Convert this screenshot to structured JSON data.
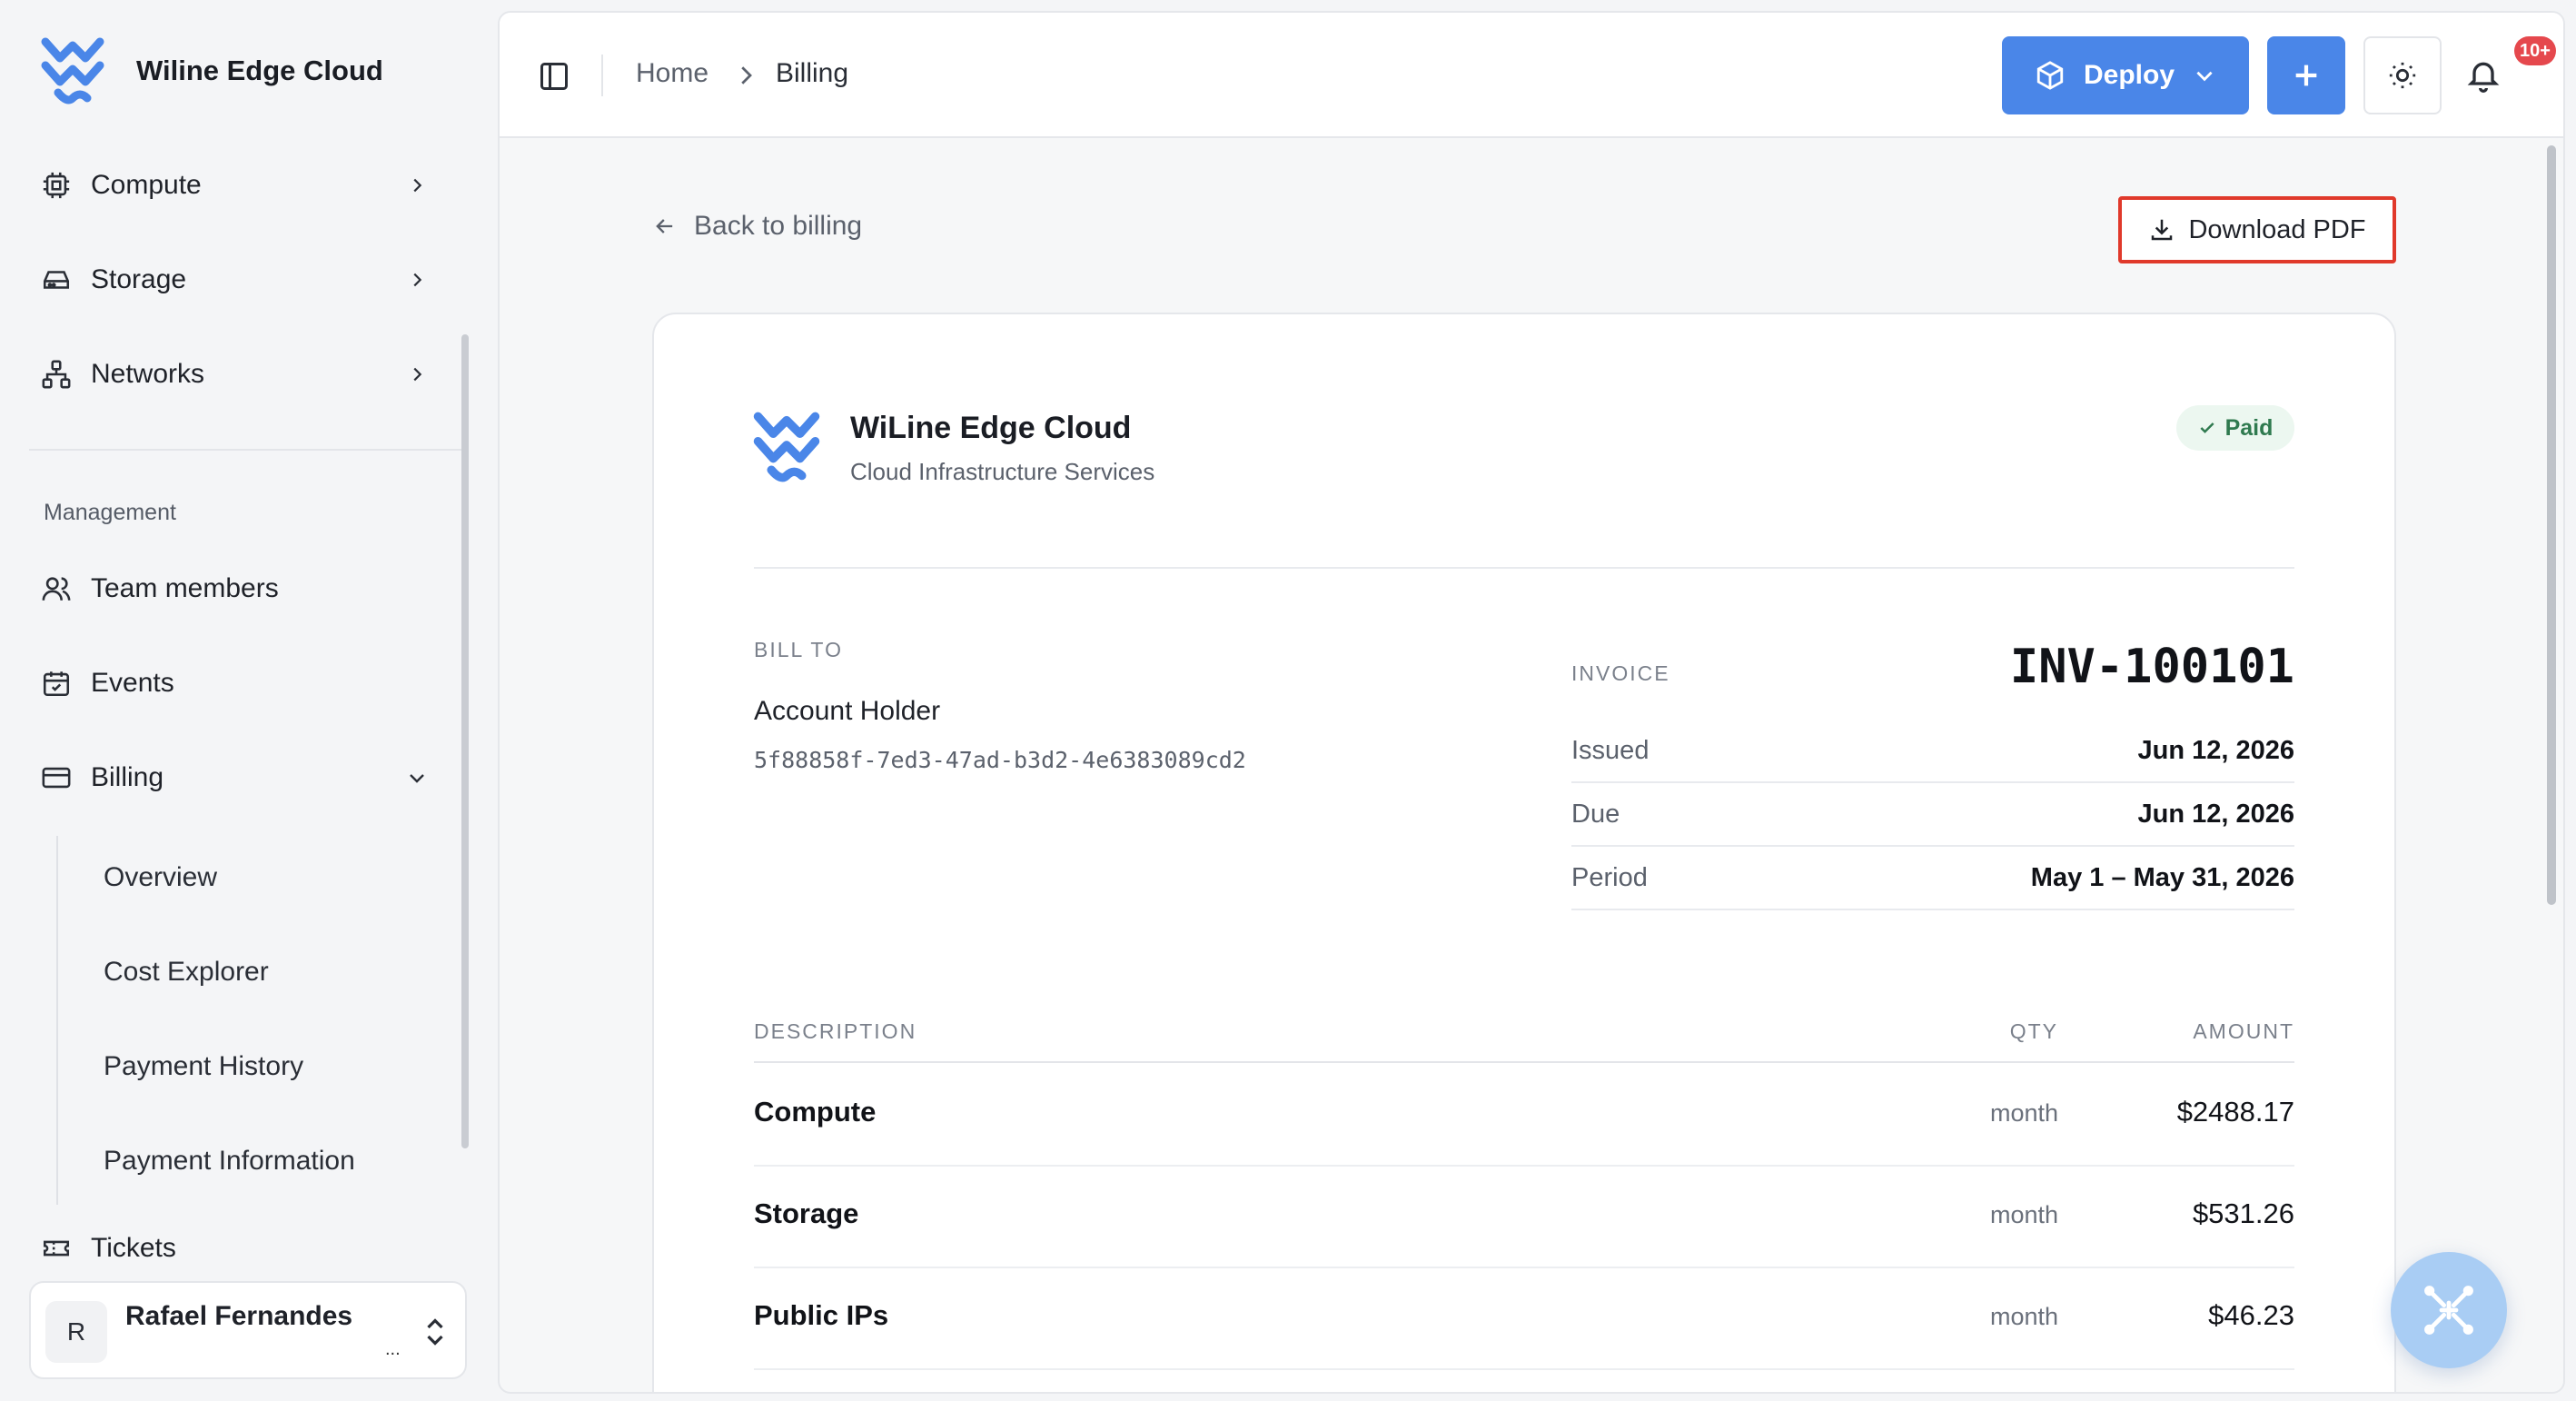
{
  "brand": {
    "name": "Wiline Edge Cloud",
    "logo_icon": "wiline-logo-icon"
  },
  "colors": {
    "accent": "#4a86e8",
    "badge": "#e5484d",
    "paid_bg": "#ecf7f0",
    "paid_text": "#2f7a4f",
    "highlight": "#e0392b"
  },
  "sidebar": {
    "items": [
      {
        "label": "Compute",
        "icon": "chip-icon"
      },
      {
        "label": "Storage",
        "icon": "drive-icon"
      },
      {
        "label": "Networks",
        "icon": "network-icon"
      }
    ],
    "management_label": "Management",
    "management_items": [
      {
        "label": "Team members",
        "icon": "users-icon"
      },
      {
        "label": "Events",
        "icon": "calendar-icon"
      },
      {
        "label": "Billing",
        "icon": "credit-card-icon"
      }
    ],
    "billing_sub": [
      "Overview",
      "Cost Explorer",
      "Payment History",
      "Payment Information"
    ],
    "tickets_label": "Tickets",
    "user": {
      "initial": "R",
      "name": "Rafael Fernandes",
      "sub": "..."
    }
  },
  "topbar": {
    "breadcrumb": {
      "home": "Home",
      "current": "Billing"
    },
    "deploy_label": "Deploy",
    "notifications_badge": "10+"
  },
  "page": {
    "back_label": "Back to billing",
    "download_label": "Download PDF"
  },
  "invoice": {
    "company": "WiLine Edge Cloud",
    "company_sub": "Cloud Infrastructure Services",
    "status": "Paid",
    "bill_to_label": "BILL TO",
    "bill_to_name": "Account Holder",
    "bill_to_id": "5f88858f-7ed3-47ad-b3d2-4e6383089cd2",
    "invoice_label": "INVOICE",
    "invoice_number": "INV-100101",
    "meta": [
      {
        "key": "Issued",
        "value": "Jun 12, 2026"
      },
      {
        "key": "Due",
        "value": "Jun 12, 2026"
      },
      {
        "key": "Period",
        "value": "May 1 – May 31, 2026"
      }
    ],
    "columns": {
      "description": "DESCRIPTION",
      "qty": "QTY",
      "amount": "AMOUNT"
    },
    "lines": [
      {
        "description": "Compute",
        "qty": "month",
        "amount": "$2488.17"
      },
      {
        "description": "Storage",
        "qty": "month",
        "amount": "$531.26"
      },
      {
        "description": "Public IPs",
        "qty": "month",
        "amount": "$46.23"
      }
    ]
  }
}
